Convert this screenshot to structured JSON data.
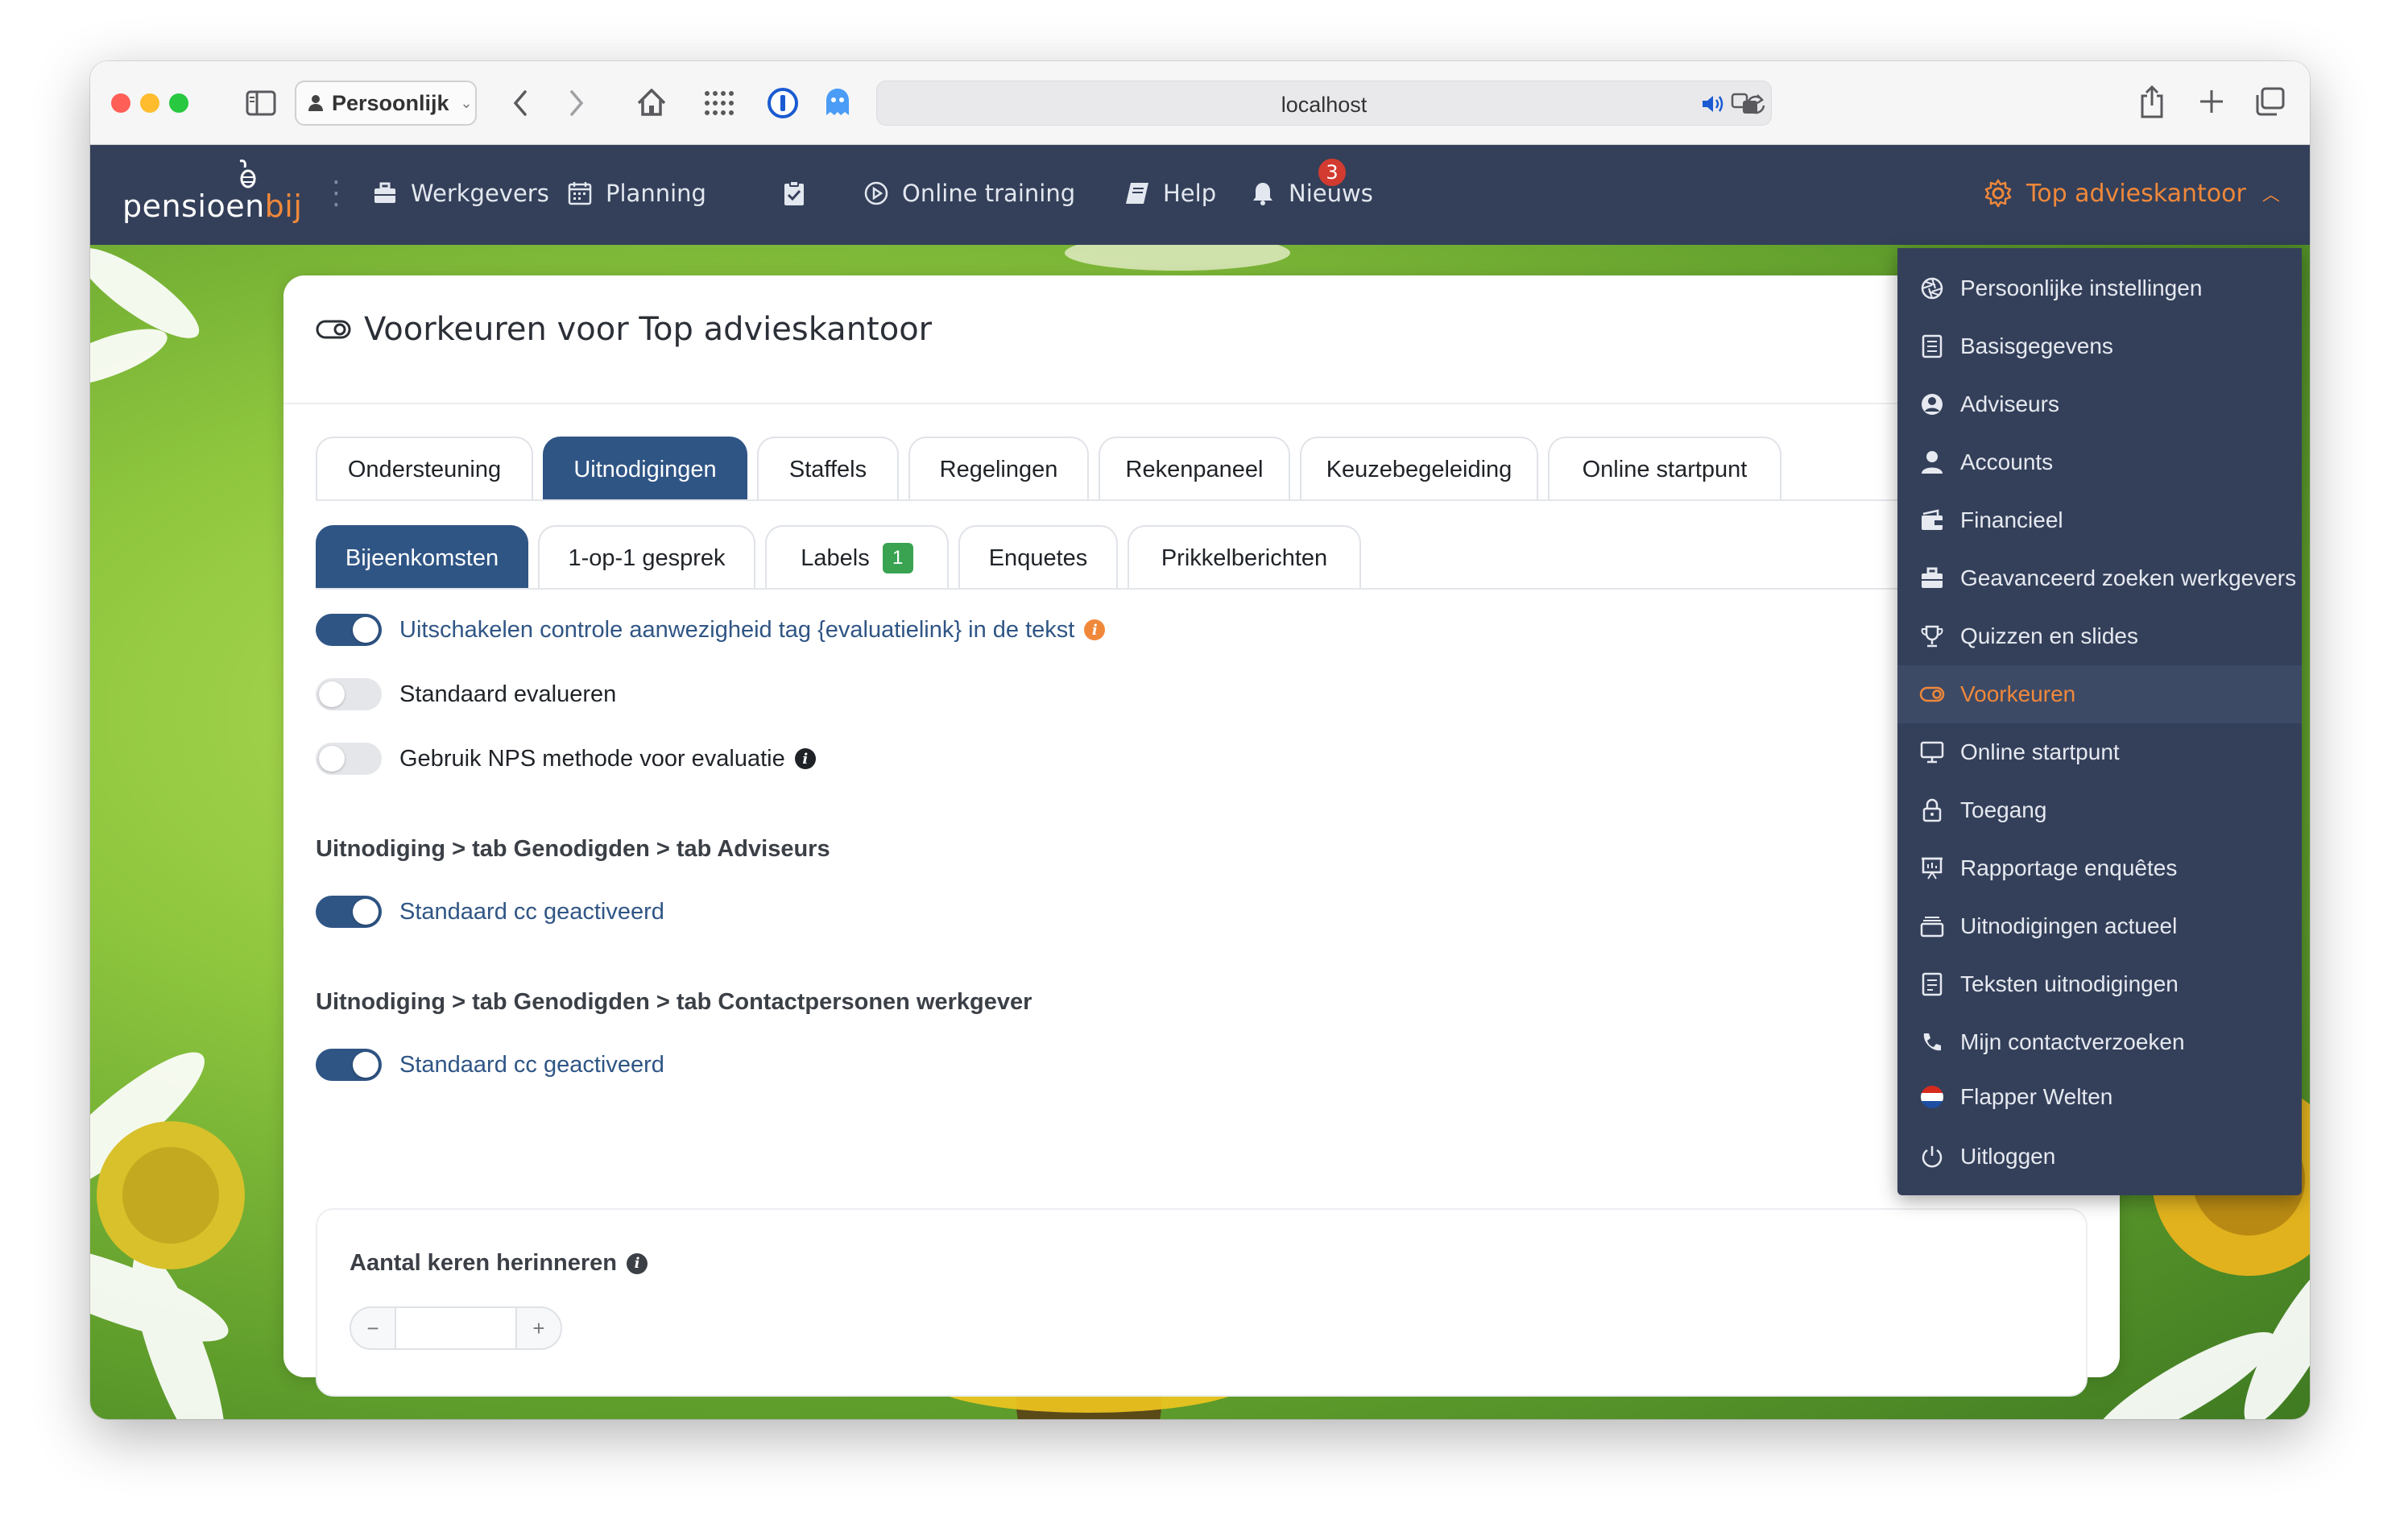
{
  "browser": {
    "profile_label": "Persoonlijk",
    "url": "localhost"
  },
  "app": {
    "logo_text_main": "pensioen",
    "logo_text_accent": "bij",
    "nav": [
      {
        "label": "Werkgevers",
        "icon": "briefcase-icon"
      },
      {
        "label": "Planning",
        "icon": "calendar-icon"
      },
      {
        "label": "",
        "icon": "clipboard-check-icon"
      },
      {
        "label": "Online training",
        "icon": "play-circle-icon"
      },
      {
        "label": "Help",
        "icon": "book-icon"
      },
      {
        "label": "Nieuws",
        "icon": "bell-icon"
      }
    ],
    "news_count": "3",
    "account_label": "Top advieskantoor",
    "accent_color": "#f0883a",
    "nav_bg": "#34405a",
    "primary_color": "#2f5585"
  },
  "page": {
    "title": "Voorkeuren voor Top advieskantoor",
    "main_tabs": [
      "Ondersteuning",
      "Uitnodigingen",
      "Staffels",
      "Regelingen",
      "Rekenpaneel",
      "Keuzebegeleiding",
      "Online startpunt"
    ],
    "active_main_tab": "Uitnodigingen",
    "sub_tabs": [
      "Bijeenkomsten",
      "1-op-1 gesprek",
      "Labels",
      "Enquetes",
      "Prikkelberichten"
    ],
    "labels_badge": "1",
    "active_sub_tab": "Bijeenkomsten",
    "toggles": [
      {
        "label": "Uitschakelen controle aanwezigheid tag {evaluatielink} in de tekst",
        "on": true
      },
      {
        "label": "Standaard evalueren",
        "on": false
      },
      {
        "label": "Gebruik NPS methode voor evaluatie",
        "on": false
      }
    ],
    "section1_heading": "Uitnodiging > tab Genodigden > tab Adviseurs",
    "section1_toggle": {
      "label": "Standaard cc geactiveerd",
      "on": true
    },
    "section2_heading": "Uitnodiging > tab Genodigden > tab Contactpersonen werkgever",
    "section2_toggle": {
      "label": "Standaard cc geactiveerd",
      "on": true
    },
    "reminder_label": "Aantal keren herinneren",
    "stepper_minus": "−",
    "stepper_plus": "+"
  },
  "menu": {
    "items": [
      {
        "label": "Persoonlijke instellingen",
        "icon": "aperture-icon"
      },
      {
        "label": "Basisgegevens",
        "icon": "document-icon"
      },
      {
        "label": "Adviseurs",
        "icon": "user-circle-icon"
      },
      {
        "label": "Accounts",
        "icon": "user-icon"
      },
      {
        "label": "Financieel",
        "icon": "wallet-icon"
      },
      {
        "label": "Geavanceerd zoeken werkgevers",
        "icon": "briefcase-icon"
      },
      {
        "label": "Quizzen en slides",
        "icon": "trophy-icon"
      },
      {
        "label": "Voorkeuren",
        "icon": "toggle-icon",
        "active": true
      },
      {
        "label": "Online startpunt",
        "icon": "monitor-icon"
      },
      {
        "label": "Toegang",
        "icon": "lock-icon"
      },
      {
        "label": "Rapportage enquêtes",
        "icon": "presentation-icon"
      },
      {
        "label": "Uitnodigingen actueel",
        "icon": "inbox-icon"
      },
      {
        "label": "Teksten uitnodigingen",
        "icon": "text-document-icon"
      },
      {
        "label": "Mijn contactverzoeken",
        "icon": "phone-icon"
      },
      {
        "label": "Flapper Welten",
        "icon": "flag-nl-icon"
      },
      {
        "label": "Uitloggen",
        "icon": "power-icon"
      }
    ]
  }
}
